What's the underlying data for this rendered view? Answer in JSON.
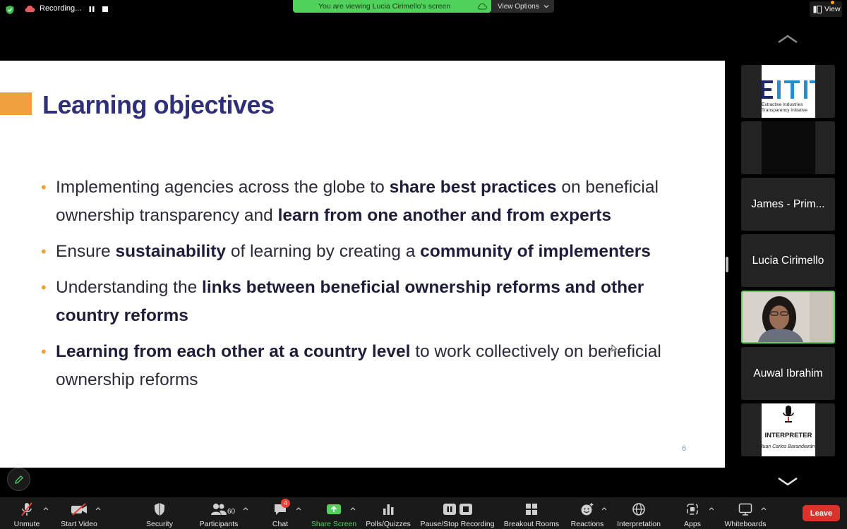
{
  "topbar": {
    "recording_label": "Recording...",
    "banner_text": "You are viewing Lucia Cirimello's screen",
    "view_options_label": "View Options",
    "view_label": "View",
    "colors": {
      "banner": "#4fd15b",
      "notify_dot": "#f5a623"
    }
  },
  "slide": {
    "title": "Learning objectives",
    "bullets": [
      {
        "parts": [
          {
            "t": "Implementing agencies across the globe to ",
            "b": false
          },
          {
            "t": "share best practices",
            "b": true
          },
          {
            "t": " on beneficial ownership transparency and ",
            "b": false
          },
          {
            "t": "learn from one another and from experts",
            "b": true
          }
        ]
      },
      {
        "parts": [
          {
            "t": "Ensure ",
            "b": false
          },
          {
            "t": "sustainability",
            "b": true
          },
          {
            "t": " of learning by creating a ",
            "b": false
          },
          {
            "t": "community of implementers",
            "b": true
          }
        ]
      },
      {
        "parts": [
          {
            "t": "Understanding the ",
            "b": false
          },
          {
            "t": "links between beneficial ownership reforms and other country reforms",
            "b": true
          }
        ]
      },
      {
        "parts": [
          {
            "t": "Learning from each other at a country level",
            "b": true
          },
          {
            "t": " to work collectively on beneficial ownership reforms",
            "b": false
          }
        ]
      }
    ],
    "page_number": "6",
    "colors": {
      "title": "#2f2f7a",
      "accent": "#f0a03c"
    }
  },
  "participants": {
    "tiles": [
      {
        "type": "eiti",
        "line1": "Extractive Industries",
        "line2": "Transparency Initiative"
      },
      {
        "type": "dark"
      },
      {
        "type": "name",
        "name": "James - Prim..."
      },
      {
        "type": "name",
        "name": "Lucia Cirimello"
      },
      {
        "type": "video"
      },
      {
        "type": "name",
        "name": "Auwal Ibrahim"
      },
      {
        "type": "interpreter",
        "line1": "INTERPRETER",
        "line2": "Juan Carlos Barandiarán"
      }
    ]
  },
  "toolbar": {
    "unmute": "Unmute",
    "start_video": "Start Video",
    "security": "Security",
    "participants": "Participants",
    "participants_count": "60",
    "chat": "Chat",
    "chat_badge": "4",
    "share_screen": "Share Screen",
    "polls": "Polls/Quizzes",
    "pause_stop": "Pause/Stop Recording",
    "breakout": "Breakout Rooms",
    "reactions": "Reactions",
    "interpretation": "Interpretation",
    "apps": "Apps",
    "whiteboards": "Whiteboards",
    "leave": "Leave",
    "colors": {
      "leave": "#d9332c",
      "share": "#4fd15b"
    }
  }
}
